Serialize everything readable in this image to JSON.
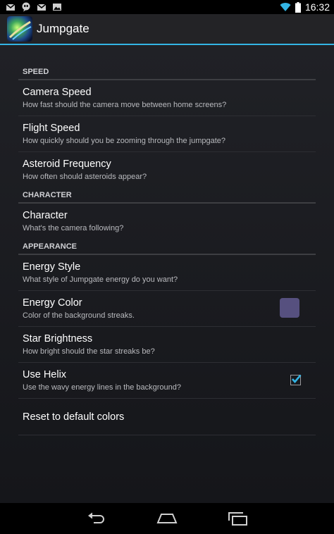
{
  "status_bar": {
    "time": "16:32",
    "left_icons": [
      "gmail-icon",
      "talk-icon",
      "gmail-icon",
      "gallery-icon"
    ],
    "right_icons": [
      "wifi-icon",
      "battery-icon"
    ]
  },
  "action_bar": {
    "title": "Jumpgate",
    "accent_color": "#33b5e5"
  },
  "sections": [
    {
      "header": "SPEED",
      "items": [
        {
          "title": "Camera Speed",
          "summary": "How fast should the camera move between home screens?"
        },
        {
          "title": "Flight Speed",
          "summary": "How quickly should you be zooming through the jumpgate?"
        },
        {
          "title": "Asteroid Frequency",
          "summary": "How often should asteroids appear?"
        }
      ]
    },
    {
      "header": "CHARACTER",
      "items": [
        {
          "title": "Character",
          "summary": "What's the camera following?"
        }
      ]
    },
    {
      "header": "APPEARANCE",
      "items": [
        {
          "title": "Energy Style",
          "summary": "What style of Jumpgate energy do you want?"
        },
        {
          "title": "Energy Color",
          "summary": "Color of the background streaks.",
          "swatch_color": "#56507f"
        },
        {
          "title": "Star Brightness",
          "summary": "How bright should the star streaks be?"
        },
        {
          "title": "Use Helix",
          "summary": "Use the wavy energy lines in the background?",
          "checked": true
        }
      ]
    }
  ],
  "reset": {
    "label": "Reset to default colors"
  },
  "nav_bar": {
    "buttons": [
      "back-icon",
      "home-icon",
      "recents-icon"
    ]
  }
}
